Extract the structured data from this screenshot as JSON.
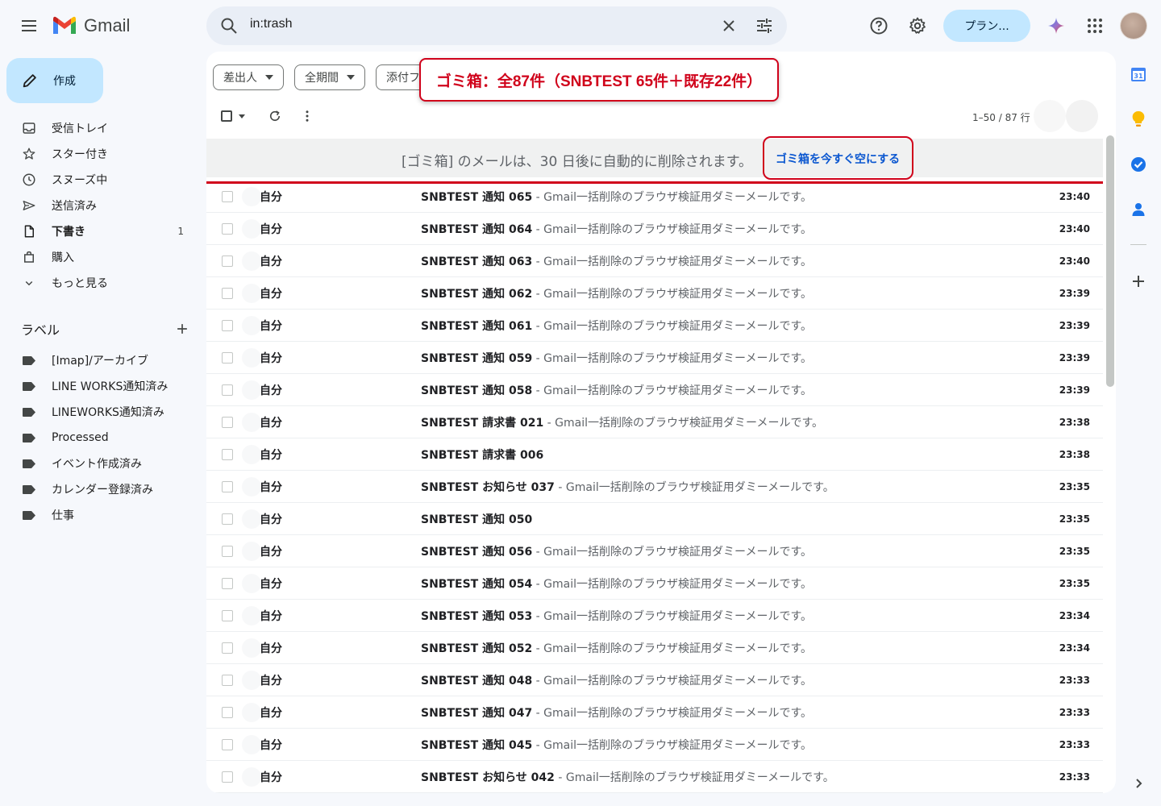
{
  "app": {
    "name": "Gmail"
  },
  "search": {
    "query": "in:trash"
  },
  "header": {
    "plan_button": "プラン..."
  },
  "sidebar": {
    "compose": "作成",
    "items": [
      {
        "label": "受信トレイ",
        "count": "",
        "icon": "inbox-icon",
        "bold": false
      },
      {
        "label": "スター付き",
        "count": "",
        "icon": "star-icon",
        "bold": false
      },
      {
        "label": "スヌーズ中",
        "count": "",
        "icon": "clock-icon",
        "bold": false
      },
      {
        "label": "送信済み",
        "count": "",
        "icon": "send-icon",
        "bold": false
      },
      {
        "label": "下書き",
        "count": "1",
        "icon": "draft-icon",
        "bold": true
      },
      {
        "label": "購入",
        "count": "",
        "icon": "shopping-bag-icon",
        "bold": false
      },
      {
        "label": "もっと見る",
        "count": "",
        "icon": "chevron-down-icon",
        "bold": false
      }
    ],
    "labels_title": "ラベル",
    "labels": [
      "[Imap]/アーカイブ",
      "LINE WORKS通知済み",
      "LINEWORKS通知済み",
      "Processed",
      "イベント作成済み",
      "カレンダー登録済み",
      "仕事"
    ]
  },
  "filters": {
    "from": "差出人",
    "date": "全期間",
    "attachment": "添付フ"
  },
  "annotation": {
    "callout": "ゴミ箱：全87件（SNBTEST 65件＋既存22件）"
  },
  "pagination": "1–50 / 87 行",
  "banner": {
    "text": "[ゴミ箱] のメールは、30 日後に自動的に削除されます。",
    "empty_link": "ゴミ箱を今すぐ空にする"
  },
  "emails": [
    {
      "sender": "自分",
      "subject": "SNBTEST 通知 065",
      "snippet": " - Gmail一括削除のブラウザ検証用ダミーメールです。",
      "time": "23:40"
    },
    {
      "sender": "自分",
      "subject": "SNBTEST 通知 064",
      "snippet": " - Gmail一括削除のブラウザ検証用ダミーメールです。",
      "time": "23:40"
    },
    {
      "sender": "自分",
      "subject": "SNBTEST 通知 063",
      "snippet": " - Gmail一括削除のブラウザ検証用ダミーメールです。",
      "time": "23:40"
    },
    {
      "sender": "自分",
      "subject": "SNBTEST 通知 062",
      "snippet": " - Gmail一括削除のブラウザ検証用ダミーメールです。",
      "time": "23:39"
    },
    {
      "sender": "自分",
      "subject": "SNBTEST 通知 061",
      "snippet": " - Gmail一括削除のブラウザ検証用ダミーメールです。",
      "time": "23:39"
    },
    {
      "sender": "自分",
      "subject": "SNBTEST 通知 059",
      "snippet": " - Gmail一括削除のブラウザ検証用ダミーメールです。",
      "time": "23:39"
    },
    {
      "sender": "自分",
      "subject": "SNBTEST 通知 058",
      "snippet": " - Gmail一括削除のブラウザ検証用ダミーメールです。",
      "time": "23:39"
    },
    {
      "sender": "自分",
      "subject": "SNBTEST 請求書 021",
      "snippet": " - Gmail一括削除のブラウザ検証用ダミーメールです。",
      "time": "23:38"
    },
    {
      "sender": "自分",
      "subject": "SNBTEST 請求書 006",
      "snippet": "",
      "time": "23:38"
    },
    {
      "sender": "自分",
      "subject": "SNBTEST お知らせ 037",
      "snippet": " - Gmail一括削除のブラウザ検証用ダミーメールです。",
      "time": "23:35"
    },
    {
      "sender": "自分",
      "subject": "SNBTEST 通知 050",
      "snippet": "",
      "time": "23:35"
    },
    {
      "sender": "自分",
      "subject": "SNBTEST 通知 056",
      "snippet": " - Gmail一括削除のブラウザ検証用ダミーメールです。",
      "time": "23:35"
    },
    {
      "sender": "自分",
      "subject": "SNBTEST 通知 054",
      "snippet": " - Gmail一括削除のブラウザ検証用ダミーメールです。",
      "time": "23:35"
    },
    {
      "sender": "自分",
      "subject": "SNBTEST 通知 053",
      "snippet": " - Gmail一括削除のブラウザ検証用ダミーメールです。",
      "time": "23:34"
    },
    {
      "sender": "自分",
      "subject": "SNBTEST 通知 052",
      "snippet": " - Gmail一括削除のブラウザ検証用ダミーメールです。",
      "time": "23:34"
    },
    {
      "sender": "自分",
      "subject": "SNBTEST 通知 048",
      "snippet": " - Gmail一括削除のブラウザ検証用ダミーメールです。",
      "time": "23:33"
    },
    {
      "sender": "自分",
      "subject": "SNBTEST 通知 047",
      "snippet": " - Gmail一括削除のブラウザ検証用ダミーメールです。",
      "time": "23:33"
    },
    {
      "sender": "自分",
      "subject": "SNBTEST 通知 045",
      "snippet": " - Gmail一括削除のブラウザ検証用ダミーメールです。",
      "time": "23:33"
    },
    {
      "sender": "自分",
      "subject": "SNBTEST お知らせ 042",
      "snippet": " - Gmail一括削除のブラウザ検証用ダミーメールです。",
      "time": "23:33"
    }
  ],
  "colors": {
    "accent": "#c2e7ff",
    "annotation": "#d0021b",
    "link": "#0b57d0",
    "background": "#f6f8fc"
  }
}
